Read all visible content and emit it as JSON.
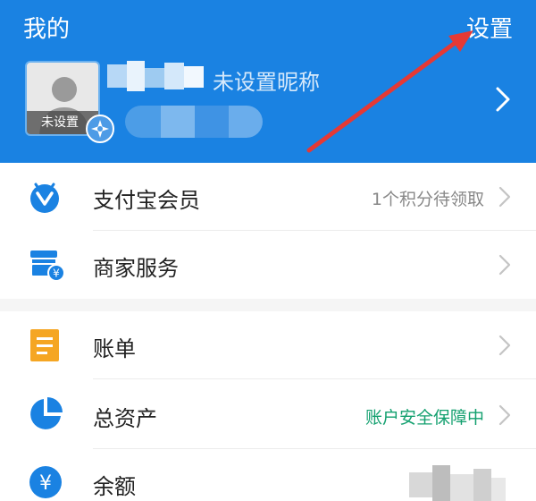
{
  "header": {
    "title": "我的",
    "settings_label": "设置",
    "avatar_label": "未设置",
    "nickname": "未设置昵称"
  },
  "menu": {
    "items": [
      {
        "label": "支付宝会员",
        "extra": "1个积分待领取",
        "icon": "member-shield-icon",
        "extra_color": "#888888"
      },
      {
        "label": "商家服务",
        "extra": "",
        "icon": "merchant-store-icon",
        "extra_color": "#888888"
      },
      {
        "label": "账单",
        "extra": "",
        "icon": "bill-icon",
        "extra_color": "#888888"
      },
      {
        "label": "总资产",
        "extra": "账户安全保障中",
        "icon": "pie-chart-icon",
        "extra_color": "#13a06f"
      },
      {
        "label": "余额",
        "extra": "",
        "icon": "yuan-icon",
        "extra_color": "#888888"
      }
    ]
  },
  "colors": {
    "header_bg": "#1a82e2",
    "accent_blue": "#1a82e2",
    "bill_orange": "#f5a623",
    "arrow_red": "#e53935"
  }
}
